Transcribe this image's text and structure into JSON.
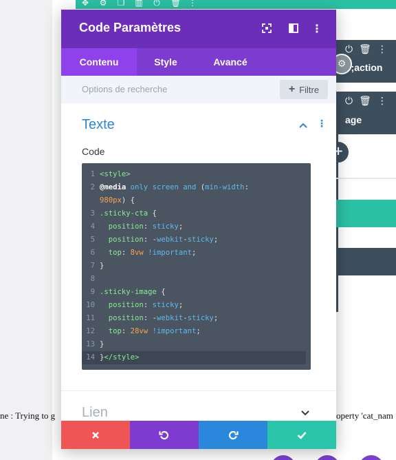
{
  "background": {
    "strip_top_label": "o;action",
    "strip_bottom_label": "age",
    "error_text_left": "ne : Trying to g",
    "error_text_right": "operty 'cat_nam"
  },
  "modal": {
    "title": "Code Paramètres",
    "tabs": [
      {
        "label": "Contenu",
        "active": true
      },
      {
        "label": "Style",
        "active": false
      },
      {
        "label": "Avancé",
        "active": false
      }
    ],
    "search": {
      "placeholder": "Options de recherche",
      "filter_label": "Filtre"
    },
    "section_title": "Texte",
    "field_label": "Code",
    "code_lines": [
      {
        "n": "1",
        "tokens": [
          [
            "c-tag",
            "<style>"
          ]
        ]
      },
      {
        "n": "2",
        "tokens": [
          [
            "c-at",
            "@media"
          ],
          [
            "c-plain",
            " "
          ],
          [
            "c-kw",
            "only"
          ],
          [
            "c-plain",
            " "
          ],
          [
            "c-kw",
            "screen"
          ],
          [
            "c-plain",
            " "
          ],
          [
            "c-kw",
            "and"
          ],
          [
            "c-plain",
            " ("
          ],
          [
            "c-kw",
            "min-width"
          ],
          [
            "c-plain",
            ":"
          ]
        ]
      },
      {
        "n": "",
        "tokens": [
          [
            "c-num",
            "980px"
          ],
          [
            "c-plain",
            ") {"
          ]
        ]
      },
      {
        "n": "3",
        "tokens": [
          [
            "c-sel",
            ".sticky-cta"
          ],
          [
            "c-plain",
            " {"
          ]
        ]
      },
      {
        "n": "4",
        "tokens": [
          [
            "c-plain",
            "  "
          ],
          [
            "c-prop",
            "position"
          ],
          [
            "c-plain",
            ": "
          ],
          [
            "c-val",
            "sticky"
          ],
          [
            "c-plain",
            ";"
          ]
        ]
      },
      {
        "n": "5",
        "tokens": [
          [
            "c-plain",
            "  "
          ],
          [
            "c-prop",
            "position"
          ],
          [
            "c-plain",
            ": "
          ],
          [
            "c-plain",
            "-"
          ],
          [
            "c-val",
            "webkit"
          ],
          [
            "c-plain",
            "-"
          ],
          [
            "c-val",
            "sticky"
          ],
          [
            "c-plain",
            ";"
          ]
        ]
      },
      {
        "n": "6",
        "tokens": [
          [
            "c-plain",
            "  "
          ],
          [
            "c-prop",
            "top"
          ],
          [
            "c-plain",
            ": "
          ],
          [
            "c-num",
            "8vw"
          ],
          [
            "c-plain",
            " "
          ],
          [
            "c-val",
            "!important"
          ],
          [
            "c-plain",
            ";"
          ]
        ]
      },
      {
        "n": "7",
        "tokens": [
          [
            "c-plain",
            "}"
          ]
        ]
      },
      {
        "n": "8",
        "tokens": []
      },
      {
        "n": "9",
        "tokens": [
          [
            "c-sel",
            ".sticky-image"
          ],
          [
            "c-plain",
            " {"
          ]
        ]
      },
      {
        "n": "10",
        "tokens": [
          [
            "c-plain",
            "  "
          ],
          [
            "c-prop",
            "position"
          ],
          [
            "c-plain",
            ": "
          ],
          [
            "c-val",
            "sticky"
          ],
          [
            "c-plain",
            ";"
          ]
        ]
      },
      {
        "n": "11",
        "tokens": [
          [
            "c-plain",
            "  "
          ],
          [
            "c-prop",
            "position"
          ],
          [
            "c-plain",
            ": "
          ],
          [
            "c-plain",
            "-"
          ],
          [
            "c-val",
            "webkit"
          ],
          [
            "c-plain",
            "-"
          ],
          [
            "c-val",
            "sticky"
          ],
          [
            "c-plain",
            ";"
          ]
        ]
      },
      {
        "n": "12",
        "tokens": [
          [
            "c-plain",
            "  "
          ],
          [
            "c-prop",
            "top"
          ],
          [
            "c-plain",
            ": "
          ],
          [
            "c-num",
            "28vw"
          ],
          [
            "c-plain",
            " "
          ],
          [
            "c-val",
            "!important"
          ],
          [
            "c-plain",
            ";"
          ]
        ]
      },
      {
        "n": "13",
        "tokens": [
          [
            "c-plain",
            "}"
          ]
        ]
      },
      {
        "n": "14",
        "tokens": [
          [
            "c-plain",
            "}"
          ],
          [
            "c-tag",
            "</style>"
          ]
        ],
        "current": true
      }
    ],
    "link_section_title": "Lien"
  },
  "colors": {
    "header": "#6c2eb9",
    "tabs": "#7e3bd0",
    "active_tab": "#8f42ec",
    "accent_blue": "#2b87da",
    "cancel": "#ef5555",
    "save": "#29c4a9"
  },
  "icons": [
    "expand-icon",
    "split-view-icon",
    "kebab-menu-icon",
    "chevron-up-icon",
    "chevron-down-icon",
    "close-icon",
    "undo-icon",
    "redo-icon",
    "check-icon"
  ]
}
